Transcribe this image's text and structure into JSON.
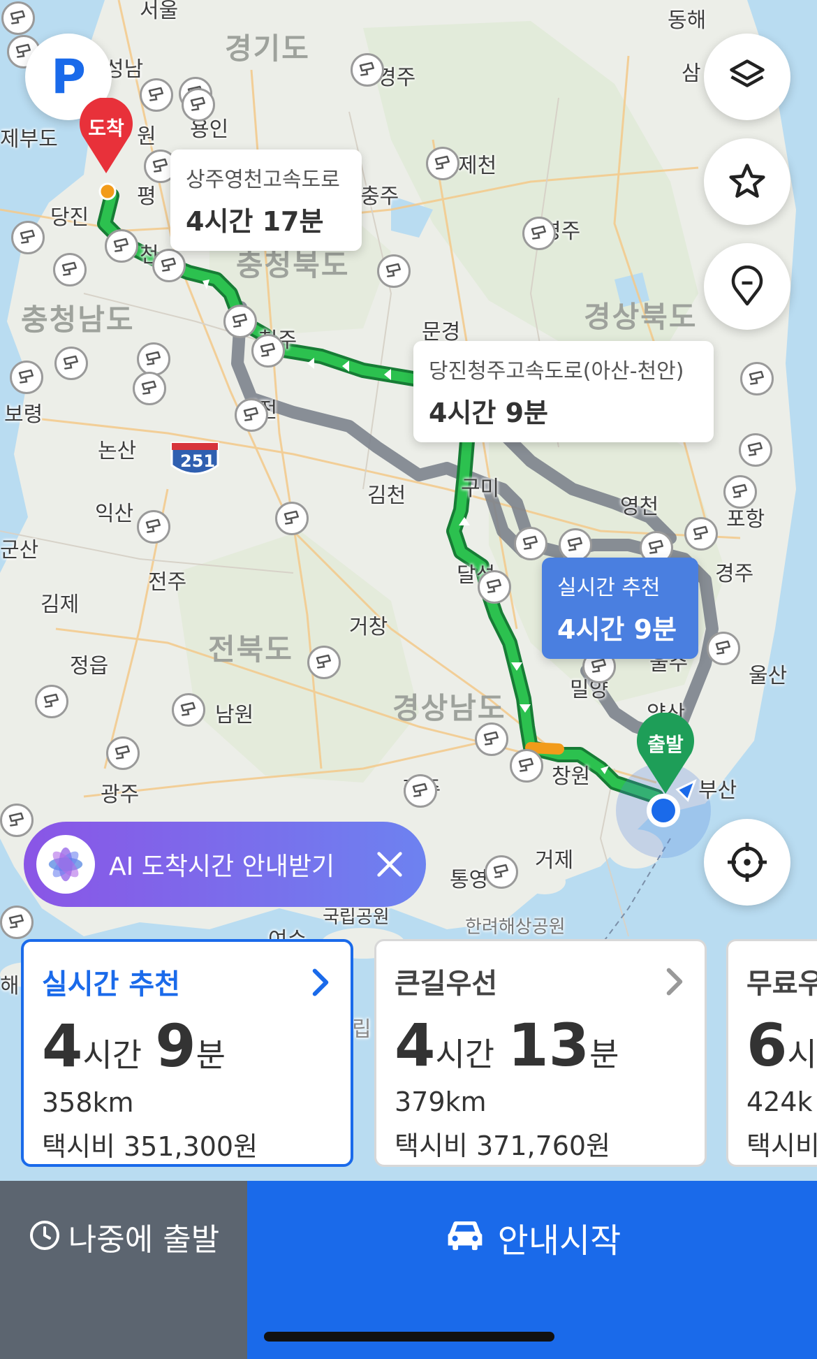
{
  "map": {
    "region_labels": [
      "경기도",
      "충청북도",
      "충청남도",
      "경상북도",
      "전북도",
      "경상남도"
    ],
    "places": [
      "서울",
      "동해",
      "삼",
      "성남",
      "경주",
      "제부도",
      "원",
      "용인",
      "당진",
      "평",
      "충주",
      "제천",
      "영주",
      "천",
      "문경",
      "청주",
      "보령",
      "대전",
      "논산",
      "251",
      "김천",
      "구미",
      "영천",
      "포항",
      "익산",
      "군산",
      "전주",
      "달성",
      "경주",
      "김제",
      "거창",
      "울주",
      "정읍",
      "밀양",
      "울산",
      "양산",
      "남원",
      "광주",
      "창원",
      "진주",
      "부산",
      "거제",
      "통영",
      "국립공원",
      "한려해상공원",
      "여수",
      "해",
      "립"
    ],
    "route_bubbles": [
      {
        "road": "상주영천고속도로",
        "time": "4시간 17분"
      },
      {
        "road": "당진청주고속도로(아산-천안)",
        "time": "4시간 9분"
      },
      {
        "road": "실시간 추천",
        "time": "4시간 9분"
      }
    ],
    "pins": {
      "arrival": "도착",
      "departure": "출발"
    },
    "parking_icon_label": "P"
  },
  "controls": {
    "layers": "layers-icon",
    "favorite": "star-icon",
    "place": "pin-icon",
    "locate": "crosshair-icon"
  },
  "ai_banner": {
    "text": "AI 도착시간 안내받기"
  },
  "routes": [
    {
      "name": "실시간 추천",
      "hours": "4",
      "hour_unit": "시간",
      "minutes": "9",
      "minute_unit": "분",
      "distance": "358km",
      "fare": "택시비 351,300원",
      "selected": true
    },
    {
      "name": "큰길우선",
      "hours": "4",
      "hour_unit": "시간",
      "minutes": "13",
      "minute_unit": "분",
      "distance": "379km",
      "fare": "택시비 371,760원",
      "selected": false
    },
    {
      "name": "무료우",
      "hours": "6",
      "hour_unit": "시",
      "minutes": "",
      "minute_unit": "",
      "distance": "424k",
      "fare": "택시비",
      "selected": false
    }
  ],
  "bottom": {
    "later_label": "나중에 출발",
    "start_label": "안내시작"
  },
  "colors": {
    "accent": "#1a6aea",
    "route_green": "#22b14c",
    "route_gray": "#8a909a",
    "arrival_pin": "#e8313a",
    "departure_pin": "#1e9e58"
  }
}
